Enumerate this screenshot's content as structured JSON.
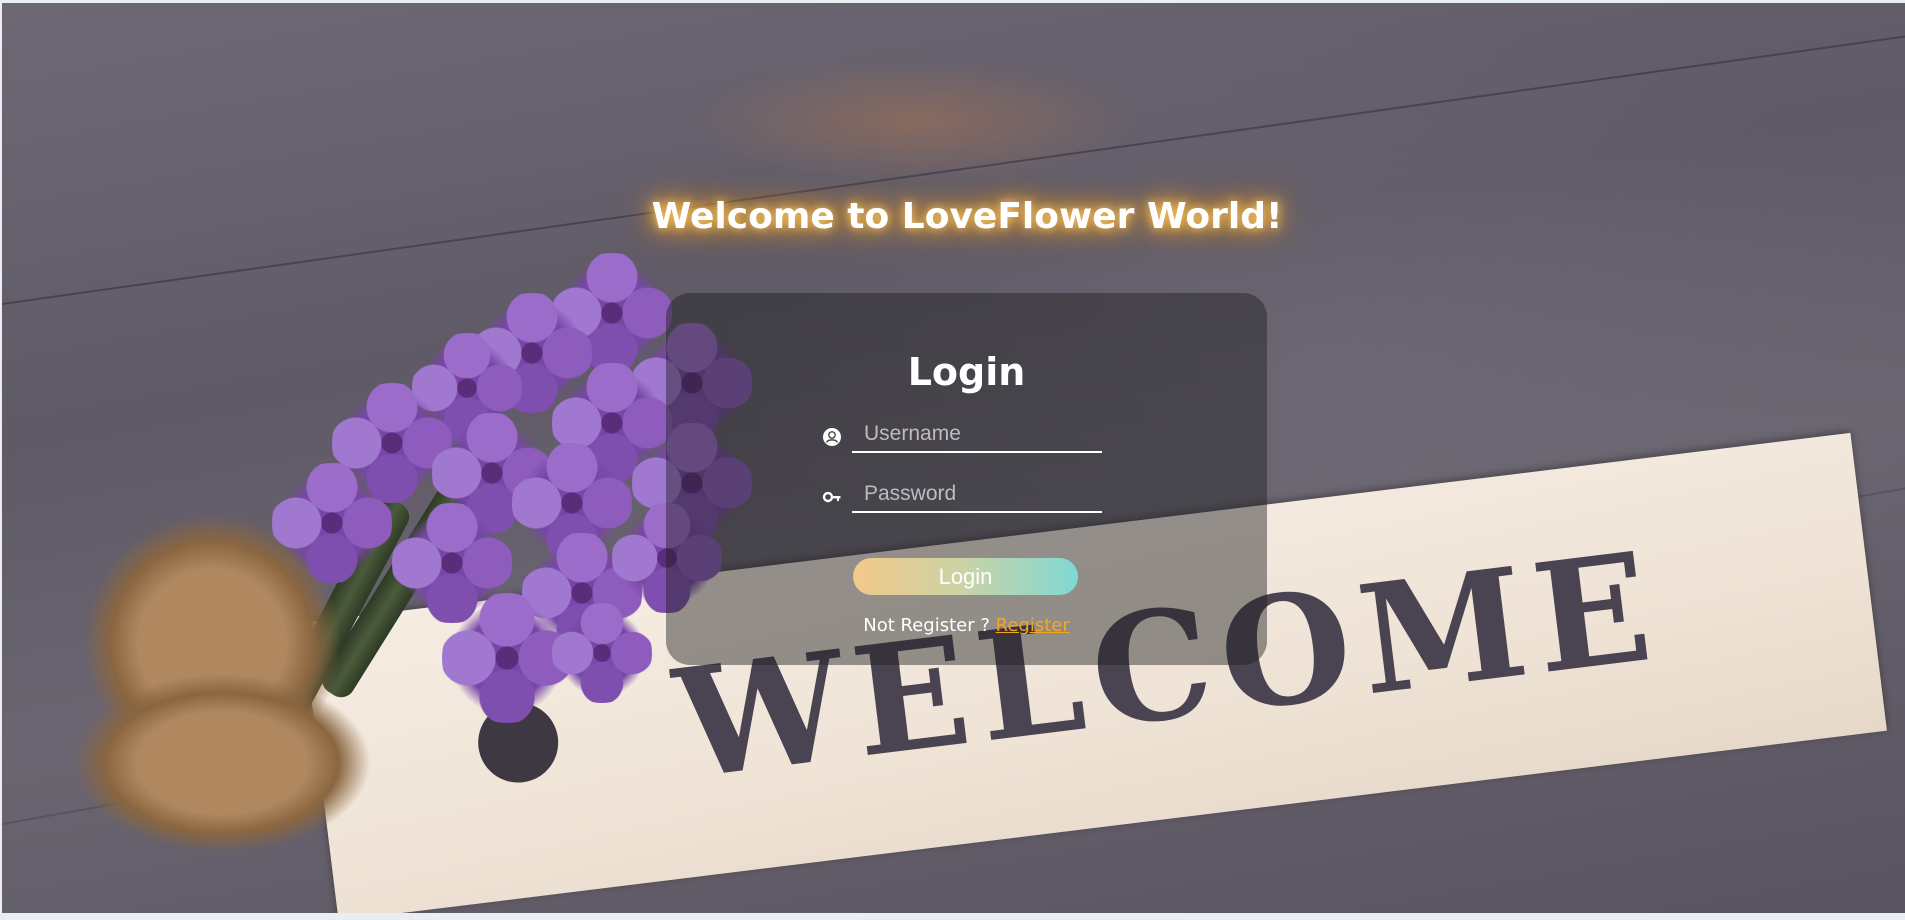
{
  "page": {
    "heading": "Welcome to LoveFlower World!"
  },
  "background": {
    "sign_text": "WELCOME"
  },
  "login": {
    "title": "Login",
    "username": {
      "placeholder": "Username",
      "value": "",
      "icon": "user-icon"
    },
    "password": {
      "placeholder": "Password",
      "value": "",
      "icon": "key-icon"
    },
    "submit_label": "Login",
    "register_prompt": "Not Register ?",
    "register_link": "Register"
  },
  "colors": {
    "accent": "#f5a623",
    "button_gradient_start": "#f2c98a",
    "button_gradient_end": "#7fd9d3"
  }
}
